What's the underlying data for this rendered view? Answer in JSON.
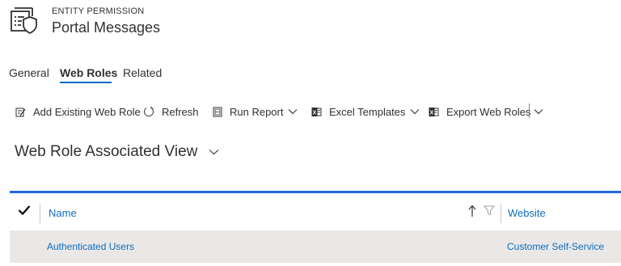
{
  "header": {
    "entity_type": "ENTITY PERMISSION",
    "entity_name": "Portal Messages",
    "icon": "entity-permission-icon"
  },
  "tabs": [
    {
      "label": "General",
      "active": false
    },
    {
      "label": "Web Roles",
      "active": true
    },
    {
      "label": "Related",
      "active": false
    }
  ],
  "toolbar": {
    "add_existing": {
      "label": "Add Existing Web Role",
      "icon": "add-existing-icon"
    },
    "refresh": {
      "label": "Refresh",
      "icon": "refresh-icon"
    },
    "run_report": {
      "label": "Run Report",
      "icon": "report-icon"
    },
    "excel_templates": {
      "label": "Excel Templates",
      "icon": "excel-icon"
    },
    "export": {
      "label": "Export Web Roles",
      "icon": "excel-export-icon"
    },
    "more": {
      "icon": "chevron-down-icon"
    }
  },
  "view": {
    "title": "Web Role Associated View"
  },
  "grid": {
    "accent": "#2266e3",
    "columns": [
      "Name",
      "Website"
    ],
    "sort_icon": "sort-ascending-icon",
    "filter_icon": "filter-icon",
    "rows": [
      {
        "name": "Authenticated Users",
        "website": "Customer Self-Service"
      }
    ]
  },
  "colors": {
    "link": "#0f6cbd",
    "text": "#323130",
    "row_hover": "#e9e8e7"
  }
}
